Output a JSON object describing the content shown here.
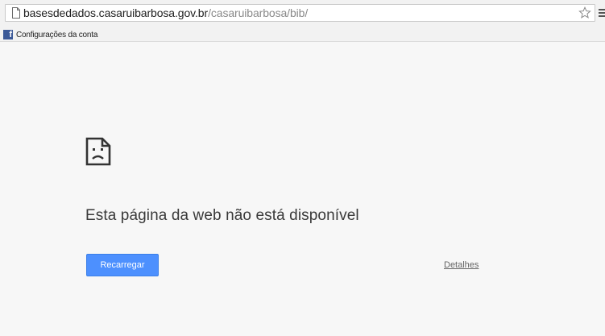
{
  "address_bar": {
    "host": "basesdedados.casaruibarbosa.gov.br",
    "path": "/casaruibarbosa/bib/"
  },
  "bookmarks": [
    {
      "label": "Configurações da conta",
      "icon": "facebook-icon"
    }
  ],
  "error_page": {
    "icon": "sad-page-icon",
    "title": "Esta página da web não está disponível",
    "reload_label": "Recarregar",
    "details_label": "Detalhes"
  },
  "colors": {
    "button": "#4d90fe",
    "facebook": "#3b5998",
    "page_background": "#f7f7f7"
  }
}
